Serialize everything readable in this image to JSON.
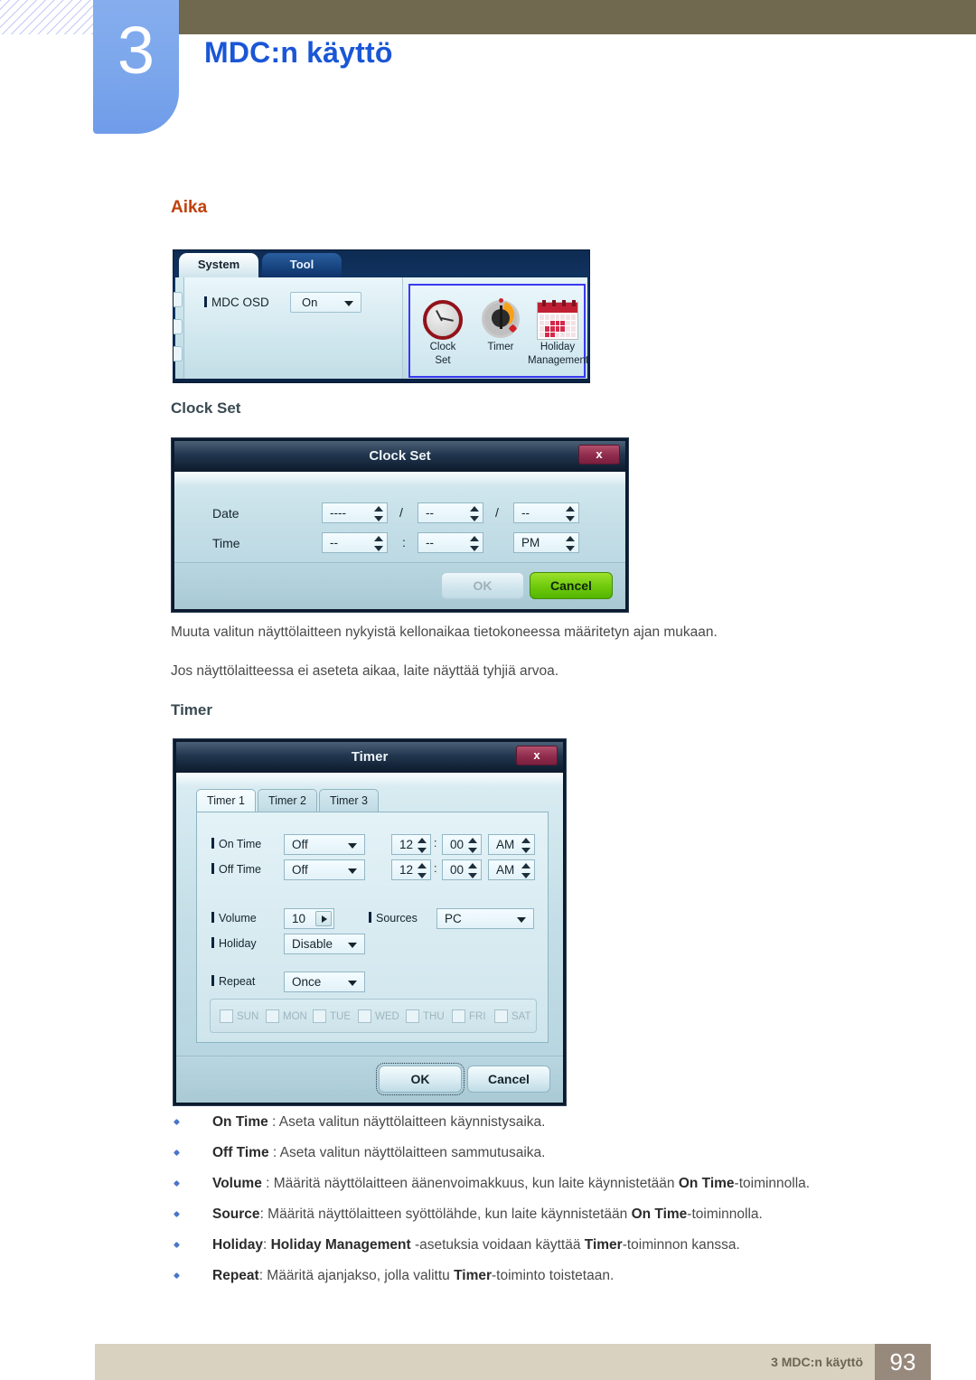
{
  "header": {
    "chapter_number": "3",
    "chapter_title": "MDC:n käyttö"
  },
  "section": {
    "heading": "Aika"
  },
  "system_panel": {
    "tabs": [
      {
        "label": "System",
        "active": true
      },
      {
        "label": "Tool",
        "active": false
      }
    ],
    "mdc_osd": {
      "label": "MDC OSD",
      "value": "On"
    },
    "icons": [
      {
        "name": "clock-set-icon",
        "caption_line1": "Clock",
        "caption_line2": "Set"
      },
      {
        "name": "timer-icon",
        "caption_line1": "Timer",
        "caption_line2": ""
      },
      {
        "name": "holiday-management-icon",
        "caption_line1": "Holiday",
        "caption_line2": "Management"
      }
    ],
    "highlight_color": "#3a39f0"
  },
  "clock_set": {
    "subheading": "Clock Set",
    "dialog_title": "Clock Set",
    "close_label": "x",
    "date_label": "Date",
    "time_label": "Time",
    "date_year": "----",
    "date_month": "--",
    "date_day": "--",
    "time_hour": "--",
    "time_minute": "--",
    "time_meridiem": "PM",
    "date_sep1": "/",
    "date_sep2": "/",
    "time_sep": ":",
    "ok_label": "OK",
    "cancel_label": "Cancel"
  },
  "paragraphs": [
    "Muuta valitun näyttölaitteen nykyistä kellonaikaa tietokoneessa määritetyn ajan mukaan.",
    "Jos näyttölaitteessa ei aseteta aikaa, laite näyttää tyhjiä arvoa."
  ],
  "timer": {
    "subheading": "Timer",
    "dialog_title": "Timer",
    "close_label": "x",
    "tabs": [
      {
        "label": "Timer 1",
        "active": true
      },
      {
        "label": "Timer 2",
        "active": false
      },
      {
        "label": "Timer 3",
        "active": false
      }
    ],
    "on_time": {
      "label": "On Time",
      "mode": "Off",
      "hour": "12",
      "minute": "00",
      "meridiem": "AM",
      "sep": ":"
    },
    "off_time": {
      "label": "Off Time",
      "mode": "Off",
      "hour": "12",
      "minute": "00",
      "meridiem": "AM",
      "sep": ":"
    },
    "volume": {
      "label": "Volume",
      "value": "10"
    },
    "sources": {
      "label": "Sources",
      "value": "PC"
    },
    "holiday": {
      "label": "Holiday",
      "value": "Disable"
    },
    "repeat": {
      "label": "Repeat",
      "value": "Once"
    },
    "days": [
      "SUN",
      "MON",
      "TUE",
      "WED",
      "THU",
      "FRI",
      "SAT"
    ],
    "ok_label": "OK",
    "cancel_label": "Cancel"
  },
  "bullets": [
    {
      "term": "On Time",
      "rest": " : Aseta valitun näyttölaitteen käynnistysaika."
    },
    {
      "term": "Off Time",
      "rest": " : Aseta valitun näyttölaitteen sammutusaika."
    },
    {
      "term": "Volume",
      "rest": " : Määritä näyttölaitteen äänenvoimakkuus, kun laite käynnistetään ",
      "term2": "On Time",
      "rest2": "-toiminnolla."
    },
    {
      "term": "Source",
      "rest": ": Määritä näyttölaitteen syöttölähde, kun laite käynnistetään ",
      "term2": "On Time",
      "rest2": "-toiminnolla."
    },
    {
      "term": "Holiday",
      "rest": ": ",
      "term2": "Holiday Management",
      "rest2": " -asetuksia voidaan käyttää ",
      "term3": "Timer",
      "rest3": "-toiminnon kanssa."
    },
    {
      "term": "Repeat",
      "rest": ": Määritä ajanjakso, jolla valittu ",
      "term2": "Timer",
      "rest2": "-toiminto toistetaan."
    }
  ],
  "footer": {
    "text": "3 MDC:n käyttö",
    "page": "93"
  }
}
